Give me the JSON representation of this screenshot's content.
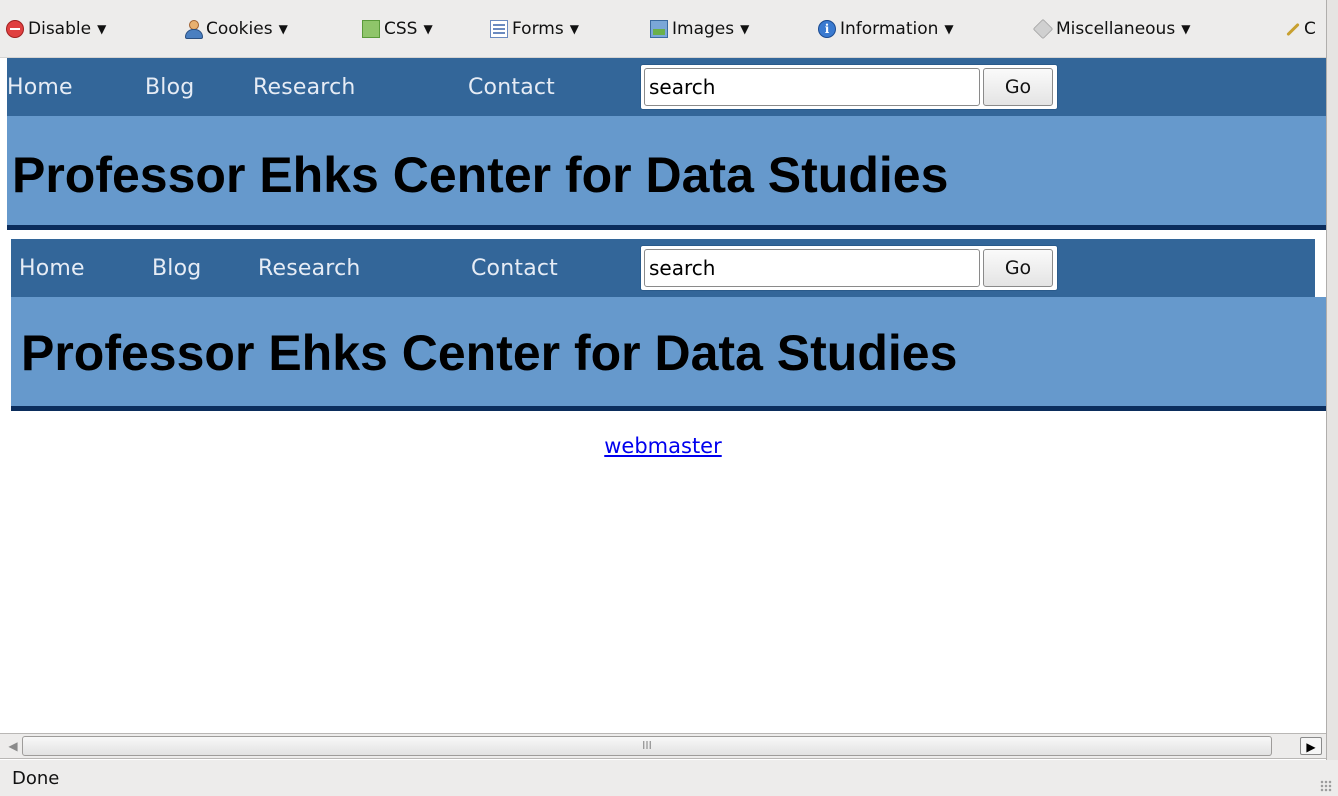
{
  "devtoolbar": {
    "items": [
      {
        "label": "Disable",
        "icon": "disable-icon"
      },
      {
        "label": "Cookies",
        "icon": "cookies-icon"
      },
      {
        "label": "CSS",
        "icon": "css-icon"
      },
      {
        "label": "Forms",
        "icon": "forms-icon"
      },
      {
        "label": "Images",
        "icon": "images-icon"
      },
      {
        "label": "Information",
        "icon": "information-icon"
      },
      {
        "label": "Miscellaneous",
        "icon": "miscellaneous-icon"
      },
      {
        "label": "C",
        "icon": "outline-brush-icon"
      }
    ],
    "dropdown_glyph": "▼"
  },
  "header1": {
    "nav": [
      "Home",
      "Blog",
      "Research",
      "Contact"
    ],
    "search": {
      "value": "search",
      "button_label": "Go"
    },
    "title": "Professor Ehks Center for Data Studies"
  },
  "header2": {
    "nav": [
      "Home",
      "Blog",
      "Research",
      "Contact"
    ],
    "search": {
      "value": "search",
      "button_label": "Go"
    },
    "title": "Professor Ehks Center for Data Studies"
  },
  "footer": {
    "link_label": "webmaster"
  },
  "scrollbar": {
    "grip_glyph": "III",
    "left_arrow": "◀",
    "right_arrow": "▶"
  },
  "status": {
    "text": "Done"
  },
  "colors": {
    "nav_bg": "#336699",
    "banner_bg": "#6699cc",
    "banner_border": "#0b2d5c",
    "link": "#0000ee"
  }
}
